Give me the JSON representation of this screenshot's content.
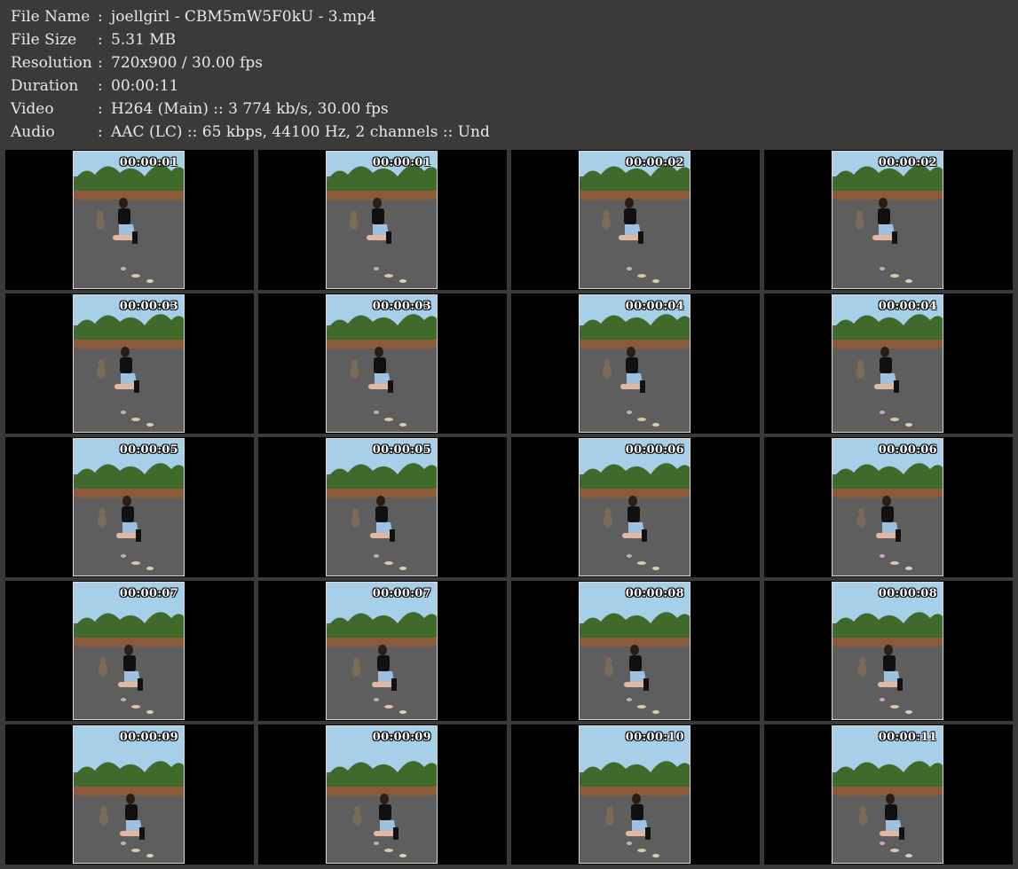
{
  "info": [
    {
      "label": "File Name",
      "value": "joellgirl - CBM5mW5F0kU - 3.mp4"
    },
    {
      "label": "File Size",
      "value": "5.31 MB"
    },
    {
      "label": "Resolution",
      "value": "720x900 / 30.00 fps"
    },
    {
      "label": "Duration",
      "value": "00:00:11"
    },
    {
      "label": "Video",
      "value": "H264 (Main) :: 3 774 kb/s, 30.00 fps"
    },
    {
      "label": "Audio",
      "value": "AAC (LC) :: 65 kbps, 44100 Hz, 2 channels :: Und"
    }
  ],
  "separator": ":",
  "frames": [
    "00:00:01",
    "00:00:01",
    "00:00:02",
    "00:00:02",
    "00:00:03",
    "00:00:03",
    "00:00:04",
    "00:00:04",
    "00:00:05",
    "00:00:05",
    "00:00:06",
    "00:00:06",
    "00:00:07",
    "00:00:07",
    "00:00:08",
    "00:00:08",
    "00:00:09",
    "00:00:09",
    "00:00:10",
    "00:00:11"
  ],
  "colors": {
    "background": "#3a3a3a",
    "cell": "#000000",
    "text": "#e8e8e8",
    "sky": "#a8cfe8",
    "foliage": "#3f6a2c",
    "asphalt": "#5e5e5e"
  }
}
